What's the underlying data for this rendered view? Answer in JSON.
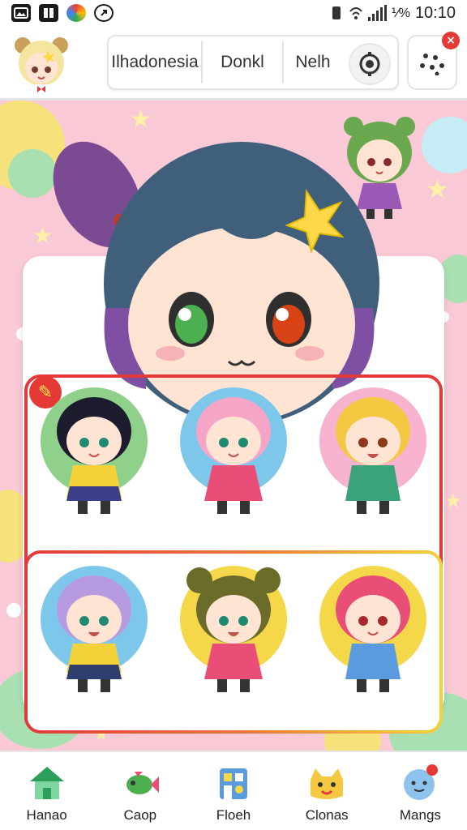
{
  "status_bar": {
    "time": "10:10",
    "battery": "⅟%",
    "icons": [
      "photo-icon",
      "book-icon",
      "chrome-icon",
      "circle-icon"
    ]
  },
  "header": {
    "search": {
      "segment_1": "Ilhadonesia",
      "segment_2": "Donkl",
      "segment_3": "Nelh"
    },
    "icons": [
      "avatar",
      "target-icon",
      "dots-menu-icon",
      "close-icon"
    ]
  },
  "hero": {
    "character": "large-chibi-girl"
  },
  "grid": {
    "rows": [
      {
        "selected": true,
        "characters": [
          "black-hair-chibi",
          "pink-hair-chibi",
          "blonde-hair-chibi"
        ]
      },
      {
        "selected": false,
        "characters": [
          "lavender-hair-chibi",
          "olive-hair-chibi",
          "red-hair-chibi"
        ]
      }
    ]
  },
  "bottom_nav": {
    "items": [
      {
        "label": "Hanao",
        "icon": "home-icon"
      },
      {
        "label": "Caop",
        "icon": "fish-icon"
      },
      {
        "label": "Floeh",
        "icon": "building-icon"
      },
      {
        "label": "Clonas",
        "icon": "cat-icon"
      },
      {
        "label": "Mangs",
        "icon": "face-icon"
      }
    ]
  },
  "colors": {
    "accent_red": "#e23a3a",
    "wallpaper_pink": "#f9c9d6",
    "badge_red": "#e53935"
  }
}
